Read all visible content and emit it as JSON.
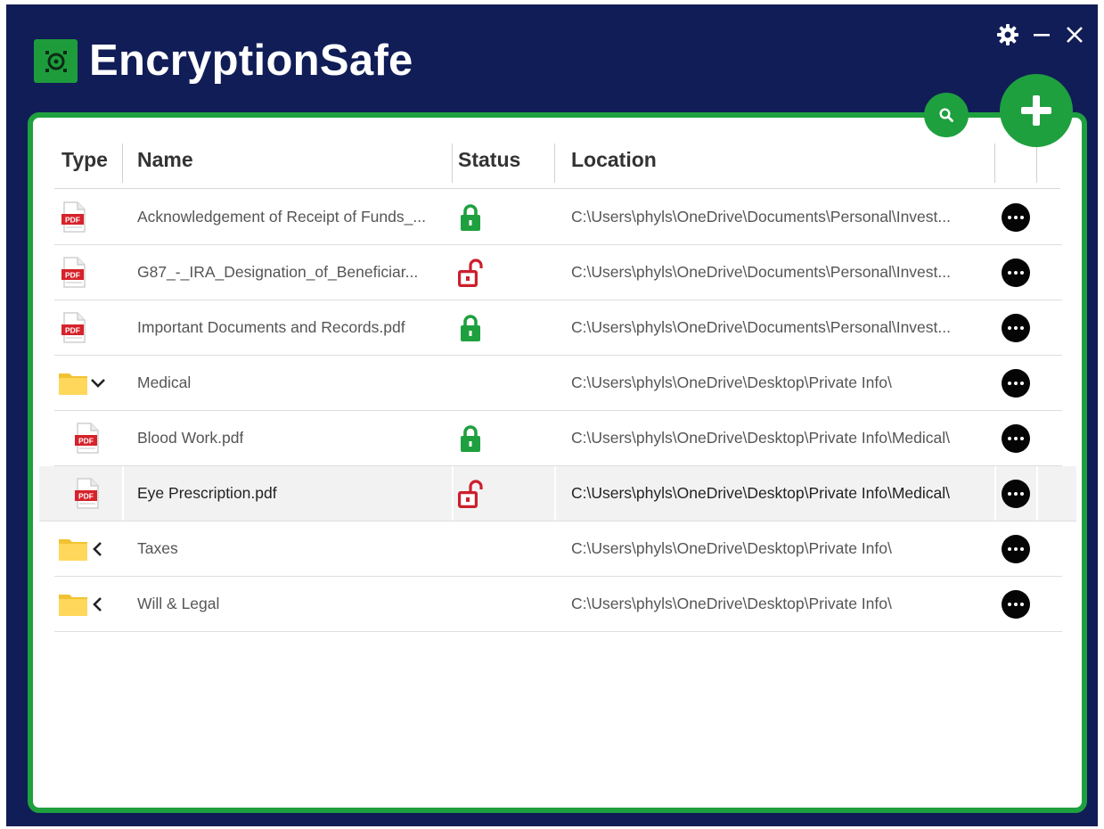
{
  "app": {
    "title": "EncryptionSafe"
  },
  "colors": {
    "background": "#111d57",
    "accent": "#1fa03f",
    "locked": "#1fa03f",
    "unlocked": "#cc1f2d"
  },
  "window_controls": [
    "gear-icon",
    "minimize-icon",
    "close-icon"
  ],
  "toolbar": {
    "search_icon": "search-icon",
    "add_icon": "plus-icon"
  },
  "table": {
    "columns": [
      "Type",
      "Name",
      "Status",
      "Location"
    ],
    "rows": [
      {
        "type": "pdf",
        "name": "Acknowledgement of Receipt of Funds_...",
        "status": "locked",
        "location": "C:\\Users\\phyls\\OneDrive\\Documents\\Personal\\Invest..."
      },
      {
        "type": "pdf",
        "name": "G87_-_IRA_Designation_of_Beneficiar...",
        "status": "unlocked",
        "location": "C:\\Users\\phyls\\OneDrive\\Documents\\Personal\\Invest..."
      },
      {
        "type": "pdf",
        "name": "Important Documents and Records.pdf",
        "status": "locked",
        "location": "C:\\Users\\phyls\\OneDrive\\Documents\\Personal\\Invest..."
      },
      {
        "type": "folder",
        "expanded": true,
        "name": "Medical",
        "status": "",
        "location": "C:\\Users\\phyls\\OneDrive\\Desktop\\Private Info\\"
      },
      {
        "type": "pdf",
        "child": true,
        "name": "Blood Work.pdf",
        "status": "locked",
        "location": "C:\\Users\\phyls\\OneDrive\\Desktop\\Private Info\\Medical\\"
      },
      {
        "type": "pdf",
        "child": true,
        "selected": true,
        "name": "Eye Prescription.pdf",
        "status": "unlocked",
        "location": "C:\\Users\\phyls\\OneDrive\\Desktop\\Private Info\\Medical\\"
      },
      {
        "type": "folder",
        "expanded": false,
        "name": "Taxes",
        "status": "",
        "location": "C:\\Users\\phyls\\OneDrive\\Desktop\\Private Info\\"
      },
      {
        "type": "folder",
        "expanded": false,
        "name": "Will & Legal",
        "status": "",
        "location": "C:\\Users\\phyls\\OneDrive\\Desktop\\Private Info\\"
      }
    ]
  },
  "icons": {
    "pdf_label": "PDF",
    "more": "more-options-icon"
  }
}
